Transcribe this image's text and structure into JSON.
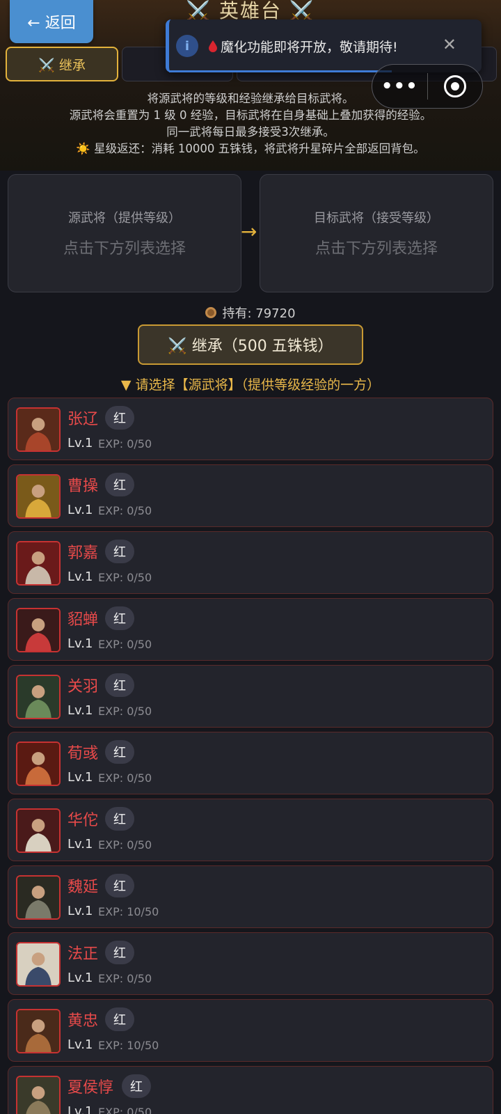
{
  "header": {
    "title": "⚔️ 英雄台 ⚔️",
    "back_label": "← 返回"
  },
  "tabs": [
    {
      "icon": "crossed-swords-icon",
      "label": "⚔️ 继承",
      "active": true
    },
    {
      "icon": "refresh-icon",
      "label": "🔄",
      "active": false
    },
    {
      "label": "",
      "active": false
    }
  ],
  "toast": {
    "text": "魔化功能即将开放，敬请期待!"
  },
  "capsule": {
    "more": "•••"
  },
  "description": [
    "将源武将的等级和经验继承给目标武将。",
    "源武将会重置为 1 级 0 经验，目标武将在自身基础上叠加获得的经验。",
    "同一武将每日最多接受3次继承。",
    "☀️ 星级返还：消耗 10000 五铢钱，将武将升星碎片全部返回背包。"
  ],
  "slots": {
    "source": {
      "title": "源武将（提供等级）",
      "hint": "点击下方列表选择"
    },
    "target": {
      "title": "目标武将（接受等级）",
      "hint": "点击下方列表选择"
    },
    "arrow": "→"
  },
  "coins": {
    "label": "持有: 79720"
  },
  "inherit_button": {
    "label": "⚔️ 继承（500 五铢钱）"
  },
  "prompt": "▼ 请选择【源武将】（提供等级经验的一方）",
  "colors": {
    "accent": "#e3b23c",
    "name_red": "#e84a4a",
    "info_blue": "#3e7bd6"
  },
  "generals": [
    {
      "name": "张辽",
      "rarity": "红",
      "level": "Lv.1",
      "exp": "EXP: 0/50"
    },
    {
      "name": "曹操",
      "rarity": "红",
      "level": "Lv.1",
      "exp": "EXP: 0/50"
    },
    {
      "name": "郭嘉",
      "rarity": "红",
      "level": "Lv.1",
      "exp": "EXP: 0/50"
    },
    {
      "name": "貂蝉",
      "rarity": "红",
      "level": "Lv.1",
      "exp": "EXP: 0/50"
    },
    {
      "name": "关羽",
      "rarity": "红",
      "level": "Lv.1",
      "exp": "EXP: 0/50"
    },
    {
      "name": "荀彧",
      "rarity": "红",
      "level": "Lv.1",
      "exp": "EXP: 0/50"
    },
    {
      "name": "华佗",
      "rarity": "红",
      "level": "Lv.1",
      "exp": "EXP: 0/50"
    },
    {
      "name": "魏延",
      "rarity": "红",
      "level": "Lv.1",
      "exp": "EXP: 10/50"
    },
    {
      "name": "法正",
      "rarity": "红",
      "level": "Lv.1",
      "exp": "EXP: 0/50"
    },
    {
      "name": "黄忠",
      "rarity": "红",
      "level": "Lv.1",
      "exp": "EXP: 10/50"
    },
    {
      "name": "夏侯惇",
      "rarity": "红",
      "level": "Lv.1",
      "exp": "EXP: 0/50"
    }
  ]
}
